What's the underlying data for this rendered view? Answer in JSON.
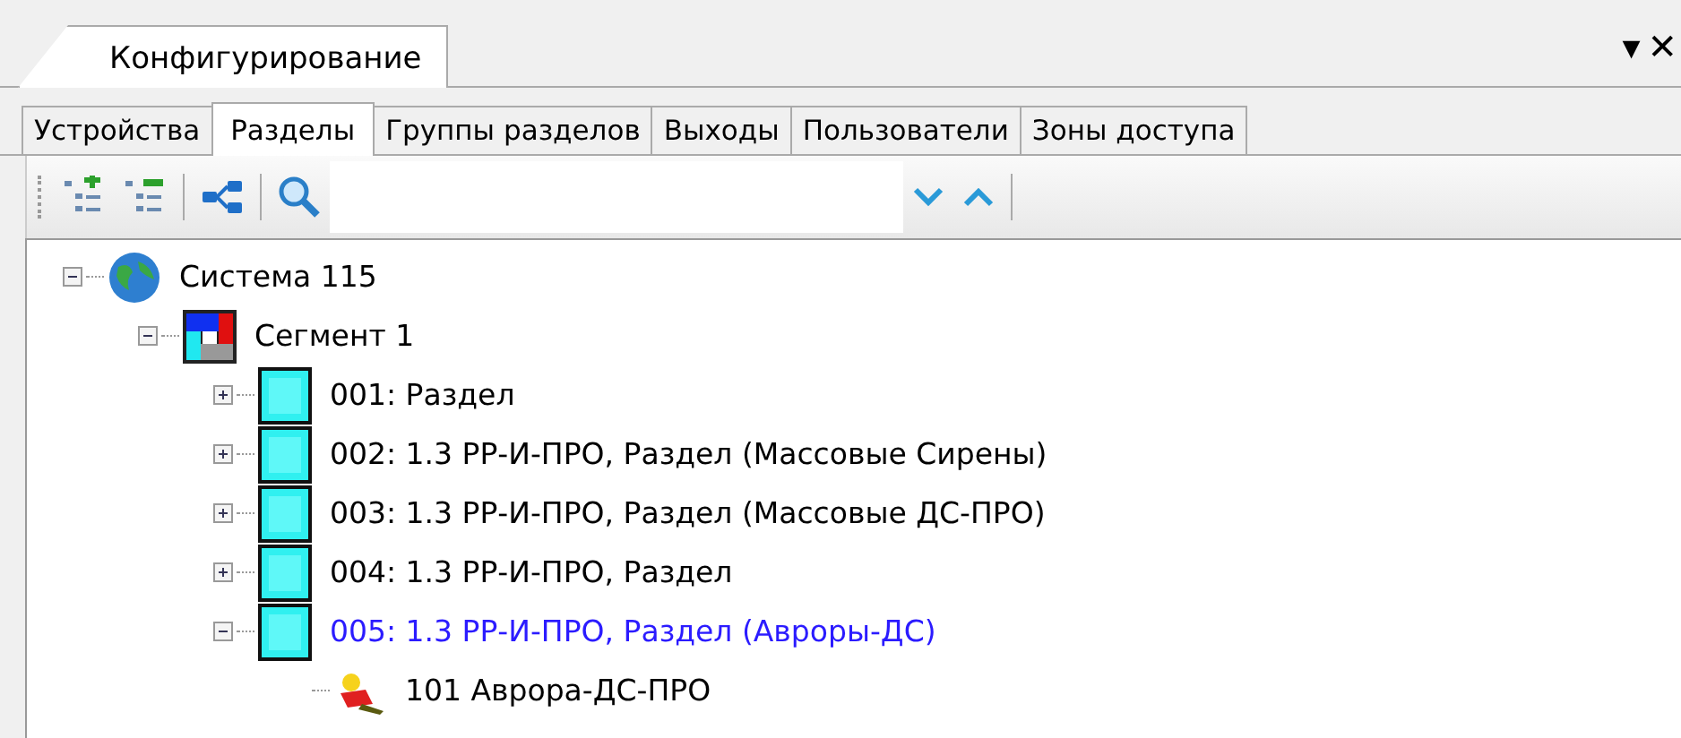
{
  "document_tab": {
    "title": "Конфигурирование"
  },
  "window_controls": {
    "menu": "▾",
    "close": "✕"
  },
  "tabs": [
    {
      "label": "Устройства",
      "selected": false
    },
    {
      "label": "Разделы",
      "selected": true
    },
    {
      "label": "Группы разделов",
      "selected": false
    },
    {
      "label": "Выходы",
      "selected": false
    },
    {
      "label": "Пользователи",
      "selected": false
    },
    {
      "label": "Зоны доступа",
      "selected": false
    }
  ],
  "tree": [
    {
      "kind": "system",
      "label": "Система 115",
      "expanded": true,
      "selected": false,
      "children": [
        {
          "kind": "segment",
          "label": "Сегмент 1",
          "expanded": true,
          "selected": false,
          "children": [
            {
              "kind": "section",
              "label": "001: Раздел",
              "expanded": false,
              "selected": false
            },
            {
              "kind": "section",
              "label": "002: 1.3 РР-И-ПРО, Раздел (Массовые Сирены)",
              "expanded": false,
              "selected": false
            },
            {
              "kind": "section",
              "label": "003: 1.3 РР-И-ПРО, Раздел (Массовые ДС-ПРО)",
              "expanded": false,
              "selected": false
            },
            {
              "kind": "section",
              "label": "004: 1.3 РР-И-ПРО, Раздел",
              "expanded": false,
              "selected": false
            },
            {
              "kind": "section",
              "label": "005: 1.3 РР-И-ПРО, Раздел (Авроры-ДС)",
              "expanded": true,
              "selected": true,
              "children": [
                {
                  "kind": "device",
                  "label": "101 Аврора-ДС-ПРО",
                  "selected": false
                }
              ]
            }
          ]
        }
      ]
    }
  ]
}
